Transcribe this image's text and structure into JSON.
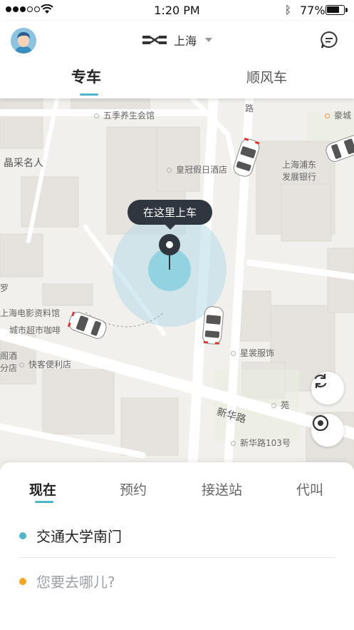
{
  "status_bar": {
    "time": "1:20 PM",
    "battery_text": "77%",
    "battery_level": 0.77
  },
  "header": {
    "city": "上海",
    "tabs": [
      {
        "label": "专车",
        "active": true
      },
      {
        "label": "顺风车",
        "active": false
      }
    ]
  },
  "map": {
    "pickup_bubble": "在这里上车",
    "labels": {
      "wuji": "五季养生会馆",
      "haocheng": "豪城",
      "jingcai": "晶采名人",
      "huangguan": "皇冠假日酒店",
      "pudong_bank_1": "上海浦东",
      "pudong_bank_2": "发展银行",
      "road_lu": "路",
      "luo": "罗",
      "film_archive": "上海电影资料馆",
      "city_market": "城市超市咖啡",
      "convenience": "快客便利店",
      "restaurant_1": "阁酒",
      "restaurant_2": "分店",
      "xingchang": "星裳服饰",
      "yuan": "苑",
      "xinhua_road": "新华路",
      "xinhua_103": "新华路103号"
    }
  },
  "panel": {
    "modes": [
      {
        "label": "现在",
        "active": true
      },
      {
        "label": "预约",
        "active": false
      },
      {
        "label": "接送站",
        "active": false
      },
      {
        "label": "代叫",
        "active": false
      }
    ],
    "pickup": "交通大学南门",
    "destination_placeholder": "您要去哪儿?"
  },
  "colors": {
    "accent": "#4fb6c8",
    "pickup_dot": "#4fb6c8",
    "destination_dot": "#f5a623",
    "bubble_bg": "#2f3640",
    "placeholder": "#9aa0a6"
  }
}
